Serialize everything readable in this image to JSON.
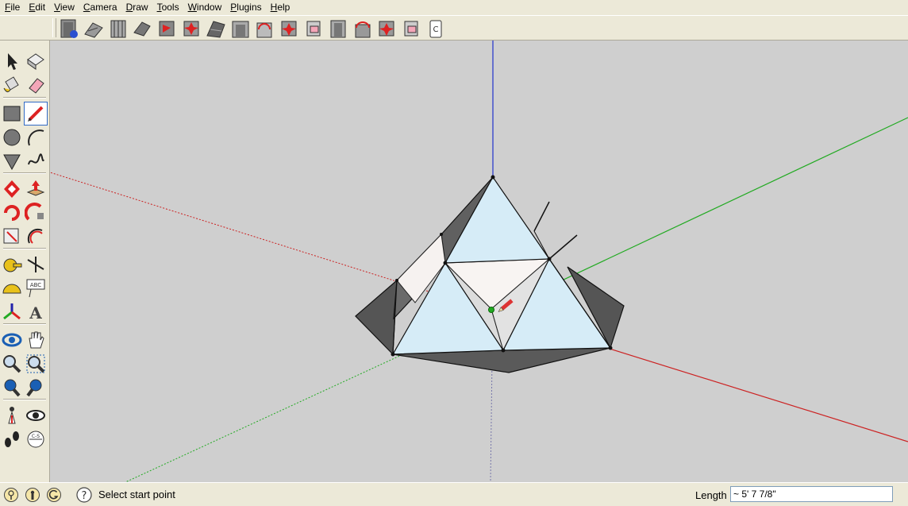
{
  "menu": [
    {
      "label": "File",
      "key": "F",
      "rest": "ile"
    },
    {
      "label": "Edit",
      "key": "E",
      "rest": "dit"
    },
    {
      "label": "View",
      "key": "V",
      "rest": "iew"
    },
    {
      "label": "Camera",
      "key": "C",
      "rest": "amera"
    },
    {
      "label": "Draw",
      "key": "D",
      "rest": "raw"
    },
    {
      "label": "Tools",
      "key": "T",
      "rest": "ools"
    },
    {
      "label": "Window",
      "key": "W",
      "rest": "indow"
    },
    {
      "label": "Plugins",
      "key": "P",
      "rest": "lugins"
    },
    {
      "label": "Help",
      "key": "H",
      "rest": "elp"
    }
  ],
  "toolbar_icons": [
    "doors-icon",
    "stairs-icon",
    "railing-icon",
    "roof-icon",
    "window-tool-icon",
    "sash-icon",
    "roof-truss-icon",
    "door-frame-icon",
    "arch-window-icon",
    "window-unit-icon",
    "eraser-frame-icon",
    "column-icon",
    "arch-door-icon",
    "star-frame-icon",
    "pink-frame-icon",
    "scroll-icon"
  ],
  "toolpanel_icons": [
    [
      "select-icon",
      "make-component-icon"
    ],
    [
      "paint-bucket-icon",
      "eraser-icon"
    ],
    [
      "rectangle-icon",
      "line-pencil-icon"
    ],
    [
      "circle-icon",
      "arc-icon"
    ],
    [
      "polygon-icon",
      "freehand-icon"
    ],
    [
      "move-icon",
      "push-pull-icon"
    ],
    [
      "rotate-icon",
      "follow-me-icon"
    ],
    [
      "scale-icon",
      "offset-icon"
    ],
    [
      "tape-measure-icon",
      "dimension-icon"
    ],
    [
      "protractor-icon",
      "text-icon"
    ],
    [
      "axes-icon",
      "3d-text-icon"
    ],
    [
      "orbit-icon",
      "pan-icon"
    ],
    [
      "zoom-icon",
      "zoom-window-icon"
    ],
    [
      "zoom-extents-icon",
      "previous-view-icon"
    ],
    [
      "position-camera-icon",
      "look-around-icon"
    ],
    [
      "walk-icon",
      "section-plane-icon"
    ]
  ],
  "toolpanel_text": {
    "abc": "ABC",
    "section": "C-S"
  },
  "status": {
    "text": "Select start point",
    "vcb_label": "Length",
    "vcb_value": "~ 5' 7 7/8\""
  },
  "colors": {
    "viewport_bg": "#cfcfcf",
    "face_front": "#d6ecf7",
    "face_back": "#5a5a5a",
    "face_inner": "#f8f4f2",
    "axis_blue": "#2233cc",
    "axis_green": "#22aa22",
    "axis_red": "#cc2222"
  }
}
